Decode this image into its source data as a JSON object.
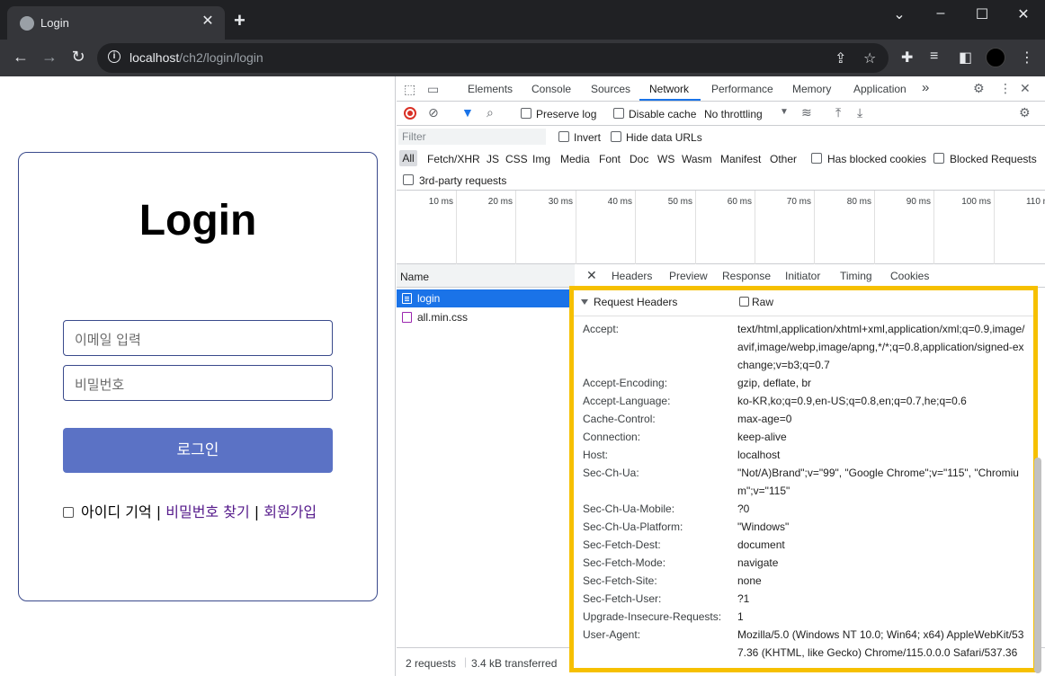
{
  "browser": {
    "tab_title": "Login",
    "tab_close": "✕",
    "new_tab": "+",
    "url_host": "localhost",
    "url_path": "/ch2/login/login"
  },
  "page": {
    "title": "Login",
    "email_placeholder": "이메일 입력",
    "password_placeholder": "비밀번호",
    "login_button": "로그인",
    "remember_label": "아이디 기억",
    "separator": "|",
    "find_password": "비밀번호 찾기",
    "signup": "회원가입"
  },
  "devtools": {
    "tabs": [
      "Elements",
      "Console",
      "Sources",
      "Network",
      "Performance",
      "Memory",
      "Application"
    ],
    "more_tabs": "»",
    "preserve_log": "Preserve log",
    "disable_cache": "Disable cache",
    "throttling": "No throttling",
    "filter_placeholder": "Filter",
    "invert": "Invert",
    "hide_data_urls": "Hide data URLs",
    "types": [
      "All",
      "Fetch/XHR",
      "JS",
      "CSS",
      "Img",
      "Media",
      "Font",
      "Doc",
      "WS",
      "Wasm",
      "Manifest",
      "Other"
    ],
    "has_blocked_cookies": "Has blocked cookies",
    "blocked_requests": "Blocked Requests",
    "third_party": "3rd-party requests",
    "timeline_ticks": [
      "10 ms",
      "20 ms",
      "30 ms",
      "40 ms",
      "50 ms",
      "60 ms",
      "70 ms",
      "80 ms",
      "90 ms",
      "100 ms",
      "110 m"
    ],
    "name_header": "Name",
    "requests": [
      {
        "name": "login"
      },
      {
        "name": "all.min.css"
      }
    ],
    "detail_tabs": [
      "Headers",
      "Preview",
      "Response",
      "Initiator",
      "Timing",
      "Cookies"
    ],
    "detail_close": "✕",
    "status": {
      "requests": "2 requests",
      "transferred": "3.4 kB transferred"
    },
    "request_headers_title": "Request Headers",
    "raw_label": "Raw",
    "headers": [
      {
        "name": "Accept:",
        "value": "text/html,application/xhtml+xml,application/xml;q=0.9,image/avif,image/webp,image/apng,*/*;q=0.8,application/signed-exchange;v=b3;q=0.7"
      },
      {
        "name": "Accept-Encoding:",
        "value": "gzip, deflate, br"
      },
      {
        "name": "Accept-Language:",
        "value": "ko-KR,ko;q=0.9,en-US;q=0.8,en;q=0.7,he;q=0.6"
      },
      {
        "name": "Cache-Control:",
        "value": "max-age=0"
      },
      {
        "name": "Connection:",
        "value": "keep-alive"
      },
      {
        "name": "Host:",
        "value": "localhost"
      },
      {
        "name": "Sec-Ch-Ua:",
        "value": "\"Not/A)Brand\";v=\"99\", \"Google Chrome\";v=\"115\", \"Chromium\";v=\"115\""
      },
      {
        "name": "Sec-Ch-Ua-Mobile:",
        "value": "?0"
      },
      {
        "name": "Sec-Ch-Ua-Platform:",
        "value": "\"Windows\""
      },
      {
        "name": "Sec-Fetch-Dest:",
        "value": "document"
      },
      {
        "name": "Sec-Fetch-Mode:",
        "value": "navigate"
      },
      {
        "name": "Sec-Fetch-Site:",
        "value": "none"
      },
      {
        "name": "Sec-Fetch-User:",
        "value": "?1"
      },
      {
        "name": "Upgrade-Insecure-Requests:",
        "value": "1"
      },
      {
        "name": "User-Agent:",
        "value": "Mozilla/5.0 (Windows NT 10.0; Win64; x64) AppleWebKit/537.36 (KHTML, like Gecko) Chrome/115.0.0.0 Safari/537.36"
      }
    ]
  },
  "colors": {
    "highlight": "#f6c000",
    "login_button": "#5b72c5",
    "card_border": "#3a4a8c",
    "selected_row": "#1a73e8"
  }
}
